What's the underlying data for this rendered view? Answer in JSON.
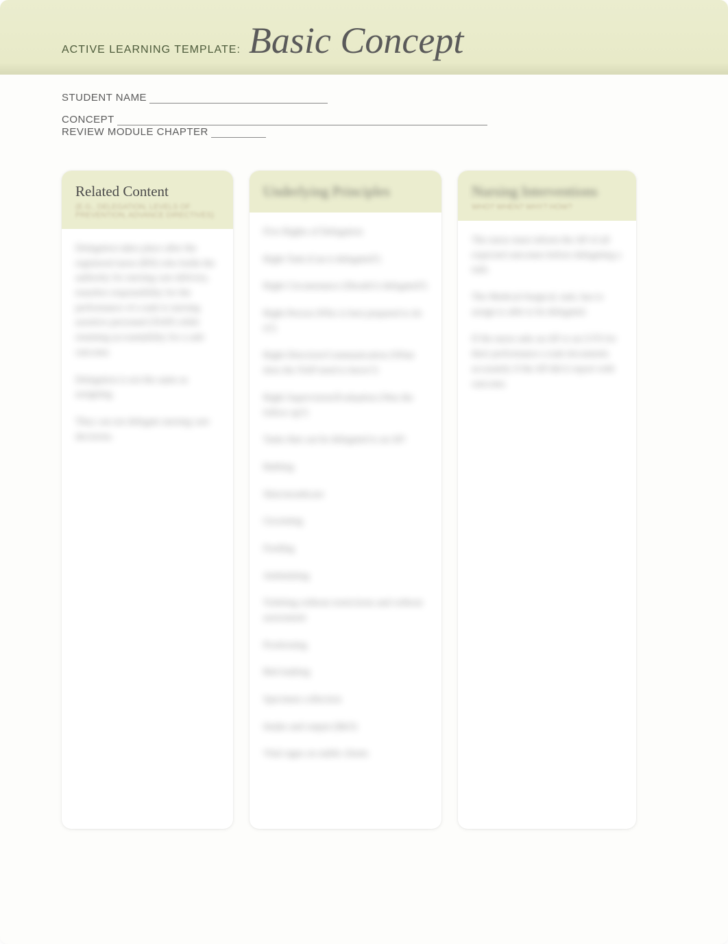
{
  "header": {
    "template_label": "ACTIVE LEARNING TEMPLATE:",
    "template_title": "Basic Concept"
  },
  "meta": {
    "student_name_label": "STUDENT NAME",
    "student_name_value": "",
    "concept_label": "CONCEPT",
    "concept_value": "",
    "review_chapter_label": "REVIEW MODULE CHAPTER",
    "review_chapter_value": ""
  },
  "columns": {
    "related": {
      "title": "Related Content",
      "subtitle": "(E.G., DELEGATION, LEVELS OF PREVENTION, ADVANCE DIRECTIVES)",
      "body": [
        "Delegation takes place after the registered nurse (RN) who holds the authority for nursing care delivery, transfers responsibility for the performance of a task to nursing assistive personnel (NAP) while retaining accountability for a safe outcome.",
        "Delegation is not the same as assigning.",
        "They can not delegate nursing care decisions."
      ]
    },
    "principles": {
      "title": "Underlying Principles",
      "subtitle": "",
      "body": [
        "Five Rights of Delegation",
        "Right Task (Can it delegated?)",
        "Right Circumstance (Should it delegated?)",
        "Right Person (Who is best prepared to do it?)",
        "Right Direction/Communication (What does the NAP need to know?)",
        "Right Supervision/Evaluation (Was the follow up?)",
        "Tasks that can be delegated to an AP:",
        "Bathing",
        "Skin/mouthcare",
        "Grooming",
        "Feeding",
        "Ambulating",
        "Toileting without restrictions and without assessment",
        "Positioning",
        "Bed making",
        "Specimen collection",
        "Intake and output (I&O)",
        "Vital signs on stable clients"
      ]
    },
    "interventions": {
      "title": "Nursing Interventions",
      "subtitle": "WHO? WHEN? WHY? HOW?",
      "body": [
        "The nurse must inform the AP of all expected outcomes before delegating a task.",
        "The Medical-Surgical, task, has to assign to able to be delegated.",
        "If the nurse asks an AP or an LVN for their performance a task documents accurately if the AP did it report with outcome."
      ]
    }
  }
}
